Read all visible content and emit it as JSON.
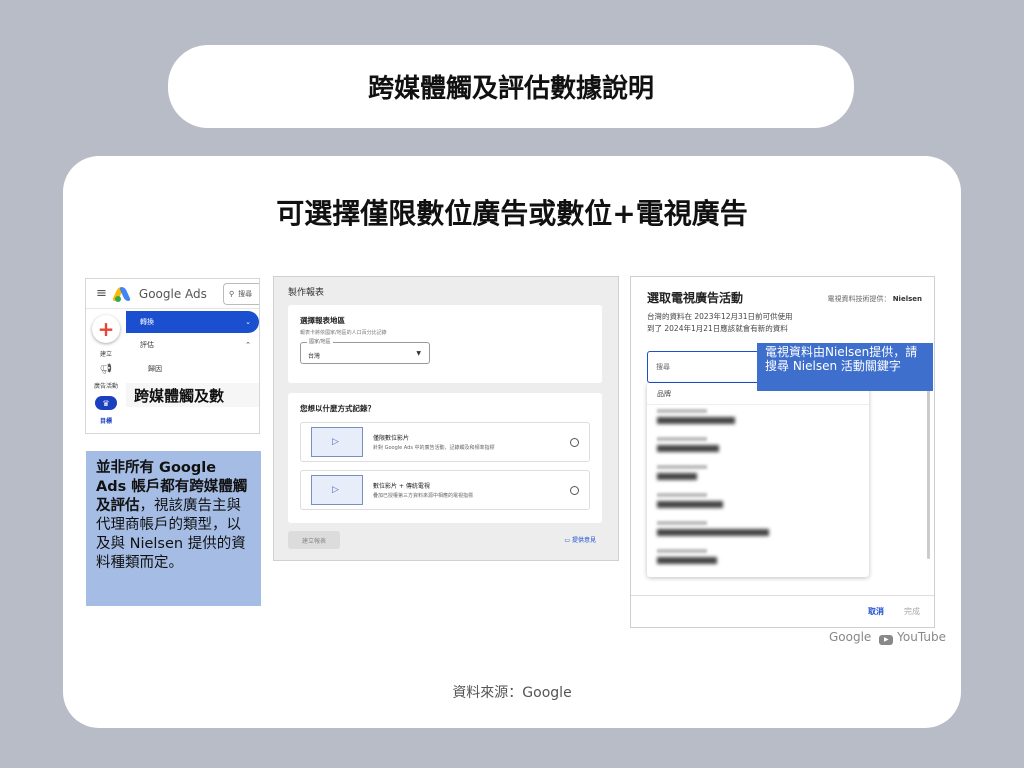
{
  "page": {
    "title": "跨媒體觸及評估數據說明",
    "subtitle": "可選擇僅限數位廣告或數位+電視廣告",
    "source": "資料來源：Google"
  },
  "ads_nav": {
    "brand": "Google Ads",
    "search_placeholder": "搜尋",
    "rail": [
      {
        "label": "建立",
        "icon": "plus-icon"
      },
      {
        "label": "廣告活動",
        "icon": "megaphone-icon"
      },
      {
        "label": "目標",
        "icon": "trophy-icon"
      }
    ],
    "menu": {
      "switch": "轉換",
      "evaluate": "評估",
      "attribution": "歸因",
      "cross_media": "跨媒體觸及數"
    }
  },
  "note": {
    "bold": "並非所有 Google Ads 帳戶都有跨媒體觸及評估",
    "rest": "，視該廣告主與代理商帳戶的類型，以及與 Nielsen 提供的資料種類而定。"
  },
  "report": {
    "title": "製作報表",
    "region_heading": "選擇報表地區",
    "region_hint": "報表卡將依國家/地區的人口百分比記錄",
    "region_field_label": "國家/地區",
    "region_value": "台灣",
    "method_heading": "您想以什麼方式記錄？",
    "options": [
      {
        "title": "僅限數位影片",
        "desc": "針對 Google Ads 中的廣告活動，記錄觸及和頻率指標"
      },
      {
        "title": "數位影片 + 傳統電視",
        "desc": "疊加已授權第三方資料來源中相應的電視指標"
      }
    ],
    "create_button": "建立報表",
    "feedback": "提供意見"
  },
  "tv": {
    "title": "選取電視廣告活動",
    "provider_label": "電視資料技術提供：",
    "provider": "Nielsen",
    "desc_line1": "台灣的資料在 2023年12月31日前可供使用",
    "desc_line2": "到了 2024年1月21日應該就會有新的資料",
    "search_value": "搜尋",
    "callout": "電視資料由Nielsen提供，請搜尋 Nielsen 活動關鍵字",
    "list_header": "品牌",
    "rows": 6,
    "cancel": "取消",
    "done": "完成"
  },
  "brands": {
    "google": "Google",
    "youtube": "YouTube"
  }
}
